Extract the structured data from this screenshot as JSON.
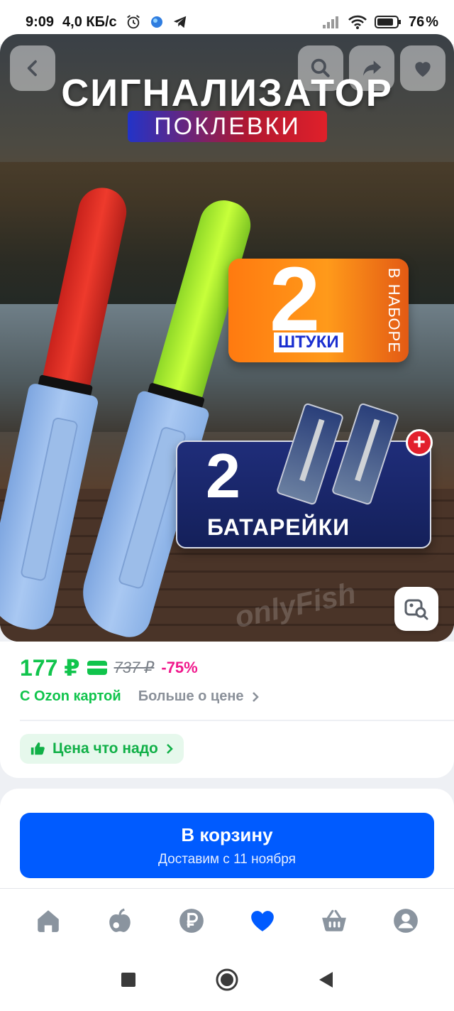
{
  "status_bar": {
    "time": "9:09",
    "speed": "4,0 КБ/с",
    "battery": "76"
  },
  "hero": {
    "title": "СИГНАЛИЗАТОР",
    "subtitle": "ПОКЛЕВКИ",
    "badge_count": "2",
    "badge_units": "ШТУКИ",
    "badge_side": "В НАБОРЕ",
    "battery_count": "2",
    "battery_label": "БАТАРЕЙКИ",
    "plus": "+",
    "watermark": "onlyFish"
  },
  "price": {
    "current": "177 ₽",
    "old": "737 ₽",
    "discount": "-75%",
    "ozon_card": "С Ozon картой",
    "more": "Больше о цене",
    "good_price": "Цена что надо"
  },
  "cart": {
    "label": "В корзину",
    "delivery": "Доставим с 11 ноября"
  },
  "tabs": [
    "home-icon",
    "fresh-icon",
    "ruble-icon",
    "favorites-icon",
    "cart-icon",
    "profile-icon"
  ],
  "colors": {
    "accent": "#005bff",
    "price_green": "#10c44c",
    "discount_pink": "#f0188c",
    "active_tab": "#005bff",
    "inactive_tab": "#8a949f"
  }
}
